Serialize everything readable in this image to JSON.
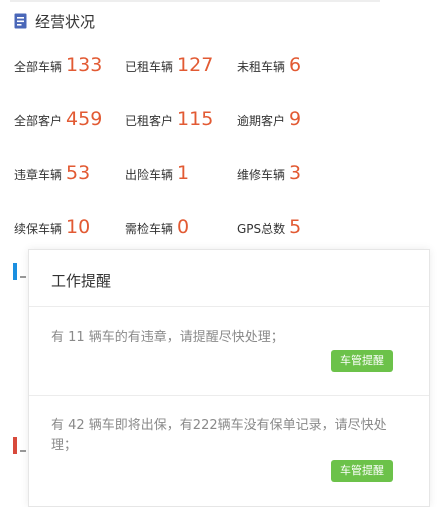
{
  "section": {
    "title": "经营状况",
    "icon": "document-icon",
    "icon_color": "#4a67b8"
  },
  "stats": [
    {
      "label": "全部车辆",
      "value": "133"
    },
    {
      "label": "已租车辆",
      "value": "127"
    },
    {
      "label": "未租车辆",
      "value": "6"
    },
    {
      "label": "全部客户",
      "value": "459"
    },
    {
      "label": "已租客户",
      "value": "115"
    },
    {
      "label": "逾期客户",
      "value": "9"
    },
    {
      "label": "违章车辆",
      "value": "53"
    },
    {
      "label": "出险车辆",
      "value": "1"
    },
    {
      "label": "维修车辆",
      "value": "3"
    },
    {
      "label": "续保车辆",
      "value": "10"
    },
    {
      "label": "需检车辆",
      "value": "0"
    },
    {
      "label": "GPS总数",
      "value": "5"
    }
  ],
  "reminder": {
    "title": "工作提醒",
    "notices": [
      {
        "text": "有 11 辆车的有违章，请提醒尽快处理；",
        "button": "车管提醒"
      },
      {
        "text": "有 42 辆车即将出保，有222辆车没有保单记录，请尽快处理；",
        "button": "车管提醒"
      }
    ]
  },
  "colors": {
    "value": "#e25a33",
    "button": "#6cc24a",
    "marker_blue": "#1b8fe0",
    "marker_red": "#d84a3c"
  }
}
